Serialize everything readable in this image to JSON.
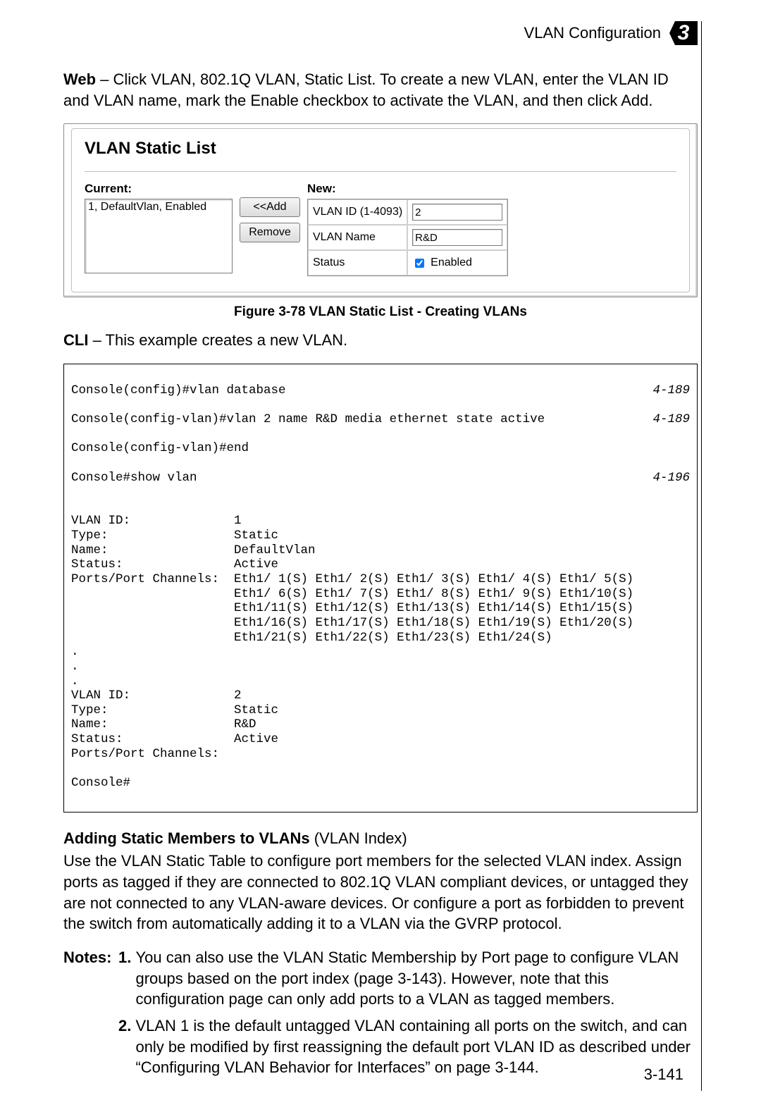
{
  "header": {
    "title": "VLAN Configuration",
    "chapter": "3"
  },
  "intro": {
    "lead": "Web",
    "text": " – Click VLAN, 802.1Q VLAN, Static List. To create a new VLAN, enter the VLAN ID and VLAN name, mark the Enable checkbox to activate the VLAN, and then click Add."
  },
  "ui": {
    "panel_title": "VLAN Static List",
    "current_label": "Current:",
    "current_item": "1, DefaultVlan, Enabled",
    "add_btn": "<<Add",
    "remove_btn": "Remove",
    "new_label": "New:",
    "vlan_id_label": "VLAN ID (1-4093)",
    "vlan_id_value": "2",
    "vlan_name_label": "VLAN Name",
    "vlan_name_value": "R&D",
    "status_label": "Status",
    "enabled_label": "Enabled",
    "enabled_checked": true
  },
  "fig_caption": "Figure 3-78   VLAN Static List - Creating VLANs",
  "cli_intro": {
    "lead": "CLI",
    "text": " – This example creates a new VLAN."
  },
  "cli": {
    "lines": [
      {
        "t": "Console(config)#vlan database",
        "r": "4-189"
      },
      {
        "t": "Console(config-vlan)#vlan 2 name R&D media ethernet state active",
        "r": "4-189"
      },
      {
        "t": "Console(config-vlan)#end",
        "r": ""
      },
      {
        "t": "Console#show vlan",
        "r": "4-196"
      }
    ],
    "body": "\nVLAN ID:              1\nType:                 Static\nName:                 DefaultVlan\nStatus:               Active\nPorts/Port Channels:  Eth1/ 1(S) Eth1/ 2(S) Eth1/ 3(S) Eth1/ 4(S) Eth1/ 5(S)\n                      Eth1/ 6(S) Eth1/ 7(S) Eth1/ 8(S) Eth1/ 9(S) Eth1/10(S)\n                      Eth1/11(S) Eth1/12(S) Eth1/13(S) Eth1/14(S) Eth1/15(S)\n                      Eth1/16(S) Eth1/17(S) Eth1/18(S) Eth1/19(S) Eth1/20(S)\n                      Eth1/21(S) Eth1/22(S) Eth1/23(S) Eth1/24(S)\n.\n.\n.\nVLAN ID:              2\nType:                 Static\nName:                 R&D\nStatus:               Active\nPorts/Port Channels:\n\nConsole#"
  },
  "section2": {
    "title_bold": "Adding Static Members to VLANs",
    "title_rest": " (VLAN Index)",
    "para": "Use the VLAN Static Table to configure port members for the selected VLAN index. Assign ports as tagged if they are connected to 802.1Q VLAN compliant devices, or untagged they are not connected to any VLAN-aware devices. Or configure a port as forbidden to prevent the switch from automatically adding it to a VLAN via the GVRP protocol."
  },
  "notes": {
    "label": "Notes:",
    "items": [
      "You can also use the VLAN Static Membership by Port page to configure VLAN groups based on the port index (page 3-143). However, note that this configuration page can only add ports to a VLAN as tagged members.",
      "VLAN 1 is the default untagged VLAN containing all ports on the switch, and can only be modified by first reassigning the default port VLAN ID as described under “Configuring VLAN Behavior for Interfaces” on page 3-144."
    ]
  },
  "page_number": "3-141"
}
